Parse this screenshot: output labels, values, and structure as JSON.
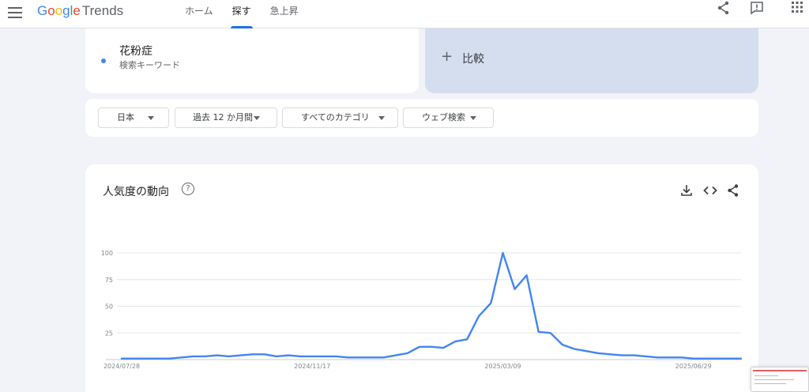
{
  "header": {
    "logo_google": "Google",
    "logo_trends": "Trends",
    "tabs": [
      {
        "label": "ホーム",
        "active": false
      },
      {
        "label": "探す",
        "active": true
      },
      {
        "label": "急上昇",
        "active": false
      }
    ],
    "icons": [
      "menu-icon",
      "share-icon",
      "feedback-icon",
      "apps-grid-icon"
    ]
  },
  "search": {
    "term": "花粉症",
    "term_type": "検索キーワード",
    "term_color": "#4285f4",
    "compare_label": "比較"
  },
  "filters": [
    {
      "label": "日本"
    },
    {
      "label": "過去 12 か月間"
    },
    {
      "label": "すべてのカテゴリ"
    },
    {
      "label": "ウェブ検索"
    }
  ],
  "interest": {
    "title": "人気度の動向",
    "icons": [
      "help-icon",
      "download-icon",
      "embed-icon",
      "share-icon"
    ]
  },
  "chart_data": {
    "type": "line",
    "title": "人気度の動向",
    "ylim": [
      0,
      100
    ],
    "yticks": [
      25,
      50,
      75,
      100
    ],
    "xticks": [
      "2024/07/28",
      "2024/11/17",
      "2025/03/09",
      "2025/06/29"
    ],
    "grid": true,
    "series": [
      {
        "name": "花粉症",
        "color": "#4285f4",
        "x": [
          "2024/07/28",
          "2024/08/04",
          "2024/08/11",
          "2024/08/18",
          "2024/08/25",
          "2024/09/01",
          "2024/09/08",
          "2024/09/15",
          "2024/09/22",
          "2024/09/29",
          "2024/10/06",
          "2024/10/13",
          "2024/10/20",
          "2024/10/27",
          "2024/11/03",
          "2024/11/10",
          "2024/11/17",
          "2024/11/24",
          "2024/12/01",
          "2024/12/08",
          "2024/12/15",
          "2024/12/22",
          "2024/12/29",
          "2025/01/05",
          "2025/01/12",
          "2025/01/19",
          "2025/01/26",
          "2025/02/02",
          "2025/02/09",
          "2025/02/16",
          "2025/02/23",
          "2025/03/02",
          "2025/03/09",
          "2025/03/16",
          "2025/03/23",
          "2025/03/30",
          "2025/04/06",
          "2025/04/13",
          "2025/04/20",
          "2025/04/27",
          "2025/05/04",
          "2025/05/11",
          "2025/05/18",
          "2025/05/25",
          "2025/06/01",
          "2025/06/08",
          "2025/06/15",
          "2025/06/22",
          "2025/06/29",
          "2025/07/06",
          "2025/07/13",
          "2025/07/20",
          "2025/07/27"
        ],
        "values": [
          1,
          1,
          1,
          1,
          1,
          2,
          3,
          3,
          4,
          3,
          4,
          5,
          5,
          3,
          4,
          3,
          3,
          3,
          3,
          2,
          2,
          2,
          2,
          4,
          6,
          12,
          12,
          11,
          17,
          19,
          41,
          53,
          100,
          66,
          79,
          26,
          25,
          14,
          10,
          8,
          6,
          5,
          4,
          4,
          3,
          2,
          2,
          2,
          1,
          1,
          1,
          1,
          1
        ]
      }
    ]
  }
}
